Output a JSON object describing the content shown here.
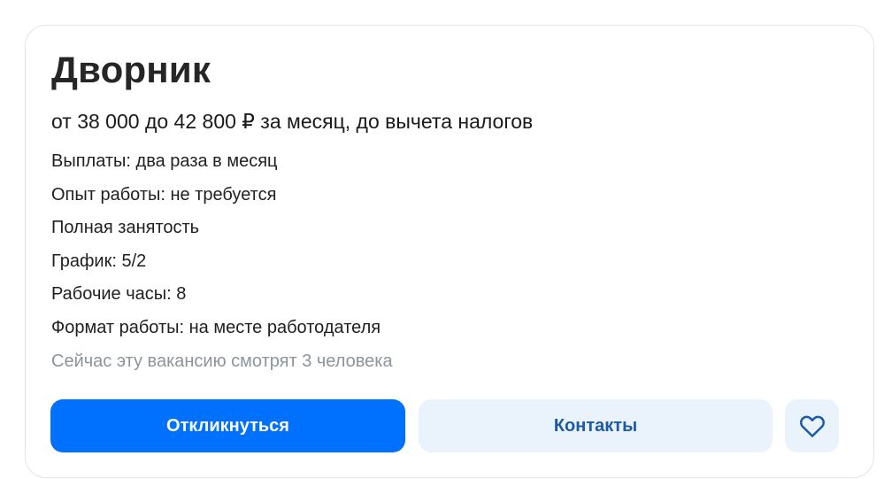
{
  "vacancy": {
    "title": "Дворник",
    "salary": "от 38 000 до 42 800 ₽ за месяц, до вычета налогов",
    "details": [
      "Выплаты: два раза в месяц",
      "Опыт работы: не требуется",
      "Полная занятость",
      "График: 5/2",
      "Рабочие часы: 8",
      "Формат работы: на месте работодателя"
    ],
    "viewers_text": "Сейчас эту вакансию смотрят 3 человека"
  },
  "actions": {
    "respond_label": "Откликнуться",
    "contacts_label": "Контакты",
    "favorite_icon": "heart-icon"
  },
  "colors": {
    "primary": "#0070ff",
    "secondary_bg": "#eaf3fc",
    "secondary_text": "#1c5aa8",
    "muted_text": "#8c949c"
  }
}
